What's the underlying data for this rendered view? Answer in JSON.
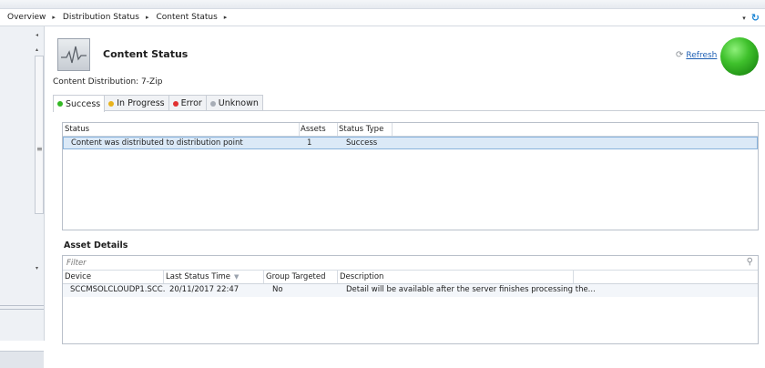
{
  "breadcrumb": {
    "items": [
      "Overview",
      "Distribution Status",
      "Content Status"
    ],
    "separator": "▸",
    "dropdown_icon": "▾",
    "refresh_icon": "↻"
  },
  "header": {
    "title": "Content Status",
    "refresh_label": "Refresh",
    "content_distribution": "Content Distribution: 7-Zip",
    "orb_color": "#3fc12c"
  },
  "tabs": [
    {
      "label": "Success",
      "color": "#33b824"
    },
    {
      "label": "In Progress",
      "color": "#e8b21b"
    },
    {
      "label": "Error",
      "color": "#e03131"
    },
    {
      "label": "Unknown",
      "color": "#a7adb6"
    }
  ],
  "status_grid": {
    "columns": [
      "Status",
      "Assets",
      "Status Type"
    ],
    "rows": [
      {
        "status": "Content was distributed to distribution point",
        "assets": "1",
        "type": "Success"
      }
    ]
  },
  "asset_details": {
    "title": "Asset Details",
    "filter_placeholder": "Filter",
    "columns": [
      "Device",
      "Last Status Time",
      "Group Targeted",
      "Description"
    ],
    "rows": [
      {
        "device": "SCCMSOLCLOUDP1.SCC...",
        "time": "20/11/2017 22:47",
        "group": "No",
        "description": "Detail will be available after the server finishes processing the..."
      }
    ]
  }
}
